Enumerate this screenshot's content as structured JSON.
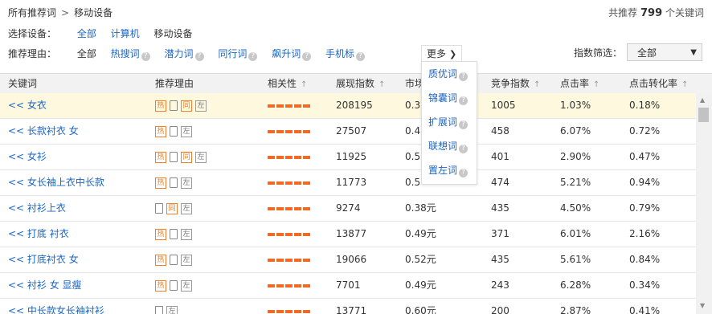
{
  "breadcrumb": {
    "root": "所有推荐词",
    "sep": ">",
    "current": "移动设备"
  },
  "summary": {
    "prefix": "共推荐",
    "count": "799",
    "suffix": "个关键词"
  },
  "device_filter": {
    "label": "选择设备：",
    "options": [
      "全部",
      "计算机",
      "移动设备"
    ]
  },
  "reason_filter": {
    "label": "推荐理由：",
    "all": "全部",
    "options": [
      "热搜词",
      "潜力词",
      "同行词",
      "飙升词",
      "手机标"
    ],
    "more": "更多"
  },
  "index_filter": {
    "label": "指数筛选：",
    "value": "全部"
  },
  "more_menu": [
    "质优词",
    "锦囊词",
    "扩展词",
    "联想词",
    "置左词"
  ],
  "columns": [
    "关键词",
    "推荐理由",
    "相关性",
    "展现指数",
    "市场",
    "竞争指数",
    "点击率",
    "点击转化率"
  ],
  "rows": [
    {
      "kw": "<< 女衣",
      "tags": [
        "热",
        "mobile",
        "同",
        "左"
      ],
      "views": "208195",
      "market": "0.3",
      "comp": "1005",
      "ctr": "1.03%",
      "cvr": "0.18%"
    },
    {
      "kw": "<< 长款衬衣 女",
      "tags": [
        "热",
        "mobile",
        "左"
      ],
      "views": "27507",
      "market": "0.4",
      "comp": "458",
      "ctr": "6.07%",
      "cvr": "0.72%"
    },
    {
      "kw": "<< 女衫",
      "tags": [
        "热",
        "mobile",
        "同",
        "左"
      ],
      "views": "11925",
      "market": "0.5",
      "comp": "401",
      "ctr": "2.90%",
      "cvr": "0.47%"
    },
    {
      "kw": "<< 女长袖上衣中长款",
      "tags": [
        "热",
        "mobile",
        "左"
      ],
      "views": "11773",
      "market": "0.5",
      "comp": "474",
      "ctr": "5.21%",
      "cvr": "0.94%"
    },
    {
      "kw": "<< 衬衫上衣",
      "tags": [
        "mobile",
        "同",
        "左"
      ],
      "views": "9274",
      "market": "0.38元",
      "comp": "435",
      "ctr": "4.50%",
      "cvr": "0.79%"
    },
    {
      "kw": "<< 打底 衬衣",
      "tags": [
        "热",
        "mobile",
        "左"
      ],
      "views": "13877",
      "market": "0.49元",
      "comp": "371",
      "ctr": "6.01%",
      "cvr": "2.16%"
    },
    {
      "kw": "<< 打底衬衣 女",
      "tags": [
        "热",
        "mobile",
        "左"
      ],
      "views": "19066",
      "market": "0.52元",
      "comp": "435",
      "ctr": "5.61%",
      "cvr": "0.84%"
    },
    {
      "kw": "<< 衬衫 女 显瘦",
      "tags": [
        "热",
        "mobile",
        "左"
      ],
      "views": "7701",
      "market": "0.49元",
      "comp": "243",
      "ctr": "6.28%",
      "cvr": "0.34%"
    },
    {
      "kw": "<< 中长款女长袖衬衫",
      "tags": [
        "mobile",
        "左"
      ],
      "views": "13771",
      "market": "0.60元",
      "comp": "200",
      "ctr": "2.87%",
      "cvr": "0.41%"
    }
  ]
}
